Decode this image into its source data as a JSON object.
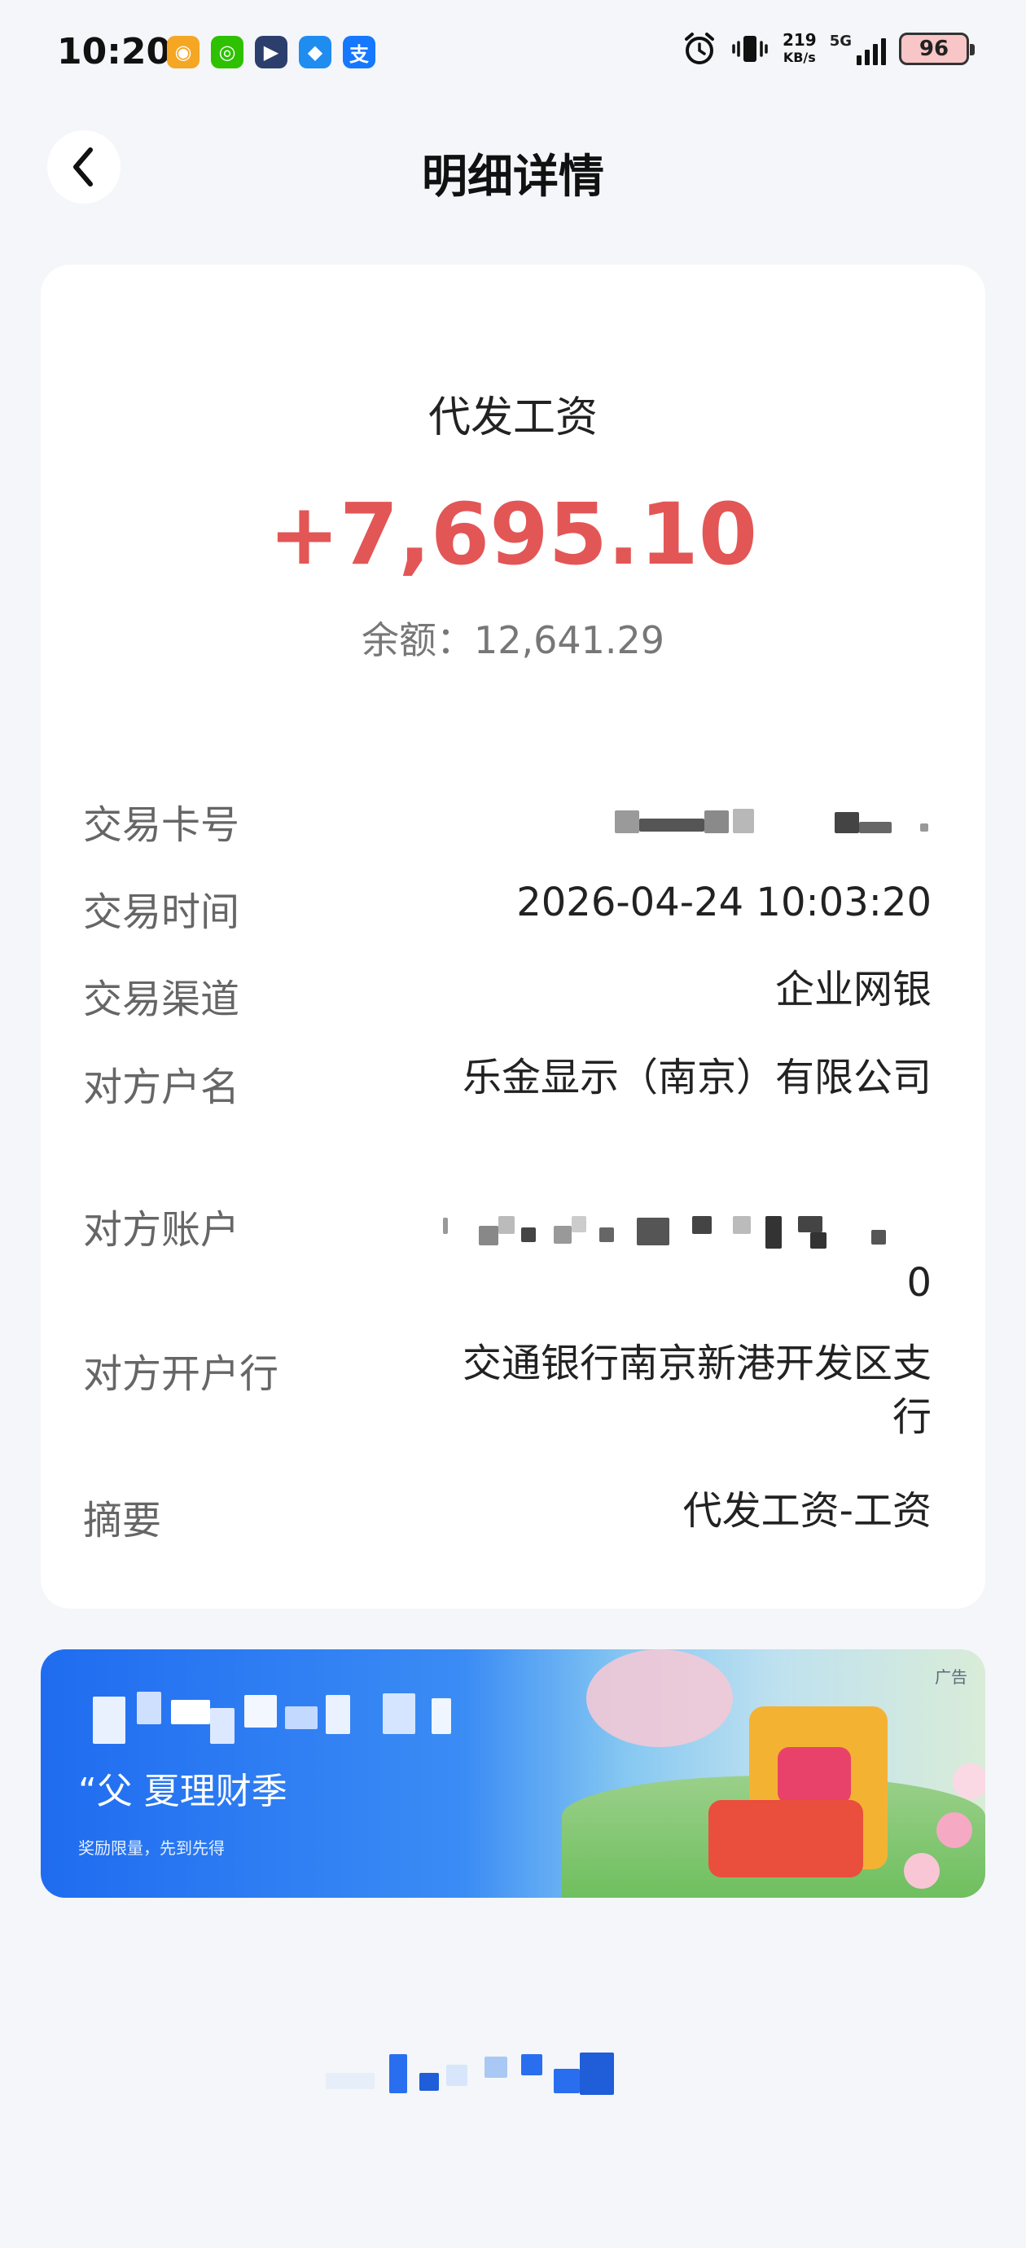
{
  "status_bar": {
    "time": "10:20",
    "apps": [
      {
        "icon": "weibo-icon",
        "glyph": "◉",
        "color": "#f5a623"
      },
      {
        "icon": "wechat-icon",
        "glyph": "◎",
        "color": "#2dc100"
      },
      {
        "icon": "video-app-icon",
        "glyph": "▶",
        "color": "#2c3e6b"
      },
      {
        "icon": "cloud-app-icon",
        "glyph": "◆",
        "color": "#1f8cf0"
      },
      {
        "icon": "alipay-icon",
        "glyph": "支",
        "color": "#1677ff"
      }
    ],
    "net_speed_value": "219",
    "net_speed_unit": "KB/s",
    "network": "5G",
    "battery": "96"
  },
  "header": {
    "title": "明细详情"
  },
  "transaction": {
    "type": "代发工资",
    "amount": "+7,695.10",
    "balance": "余额：12,641.29",
    "amount_color": "#e35656"
  },
  "details": {
    "card_no_label": "交易卡号",
    "time_label": "交易时间",
    "time_value": "2026-04-24 10:03:20",
    "channel_label": "交易渠道",
    "channel_value": "企业网银",
    "payer_name_label": "对方户名",
    "payer_name_value": "乐金显示（南京）有限公司",
    "payer_account_label": "对方账户",
    "payer_account_tail": "0",
    "payer_bank_label": "对方开户行",
    "payer_bank_value": "交通银行南京新港开发区支行",
    "memo_label": "摘要",
    "memo_value": "代发工资-工资"
  },
  "ad": {
    "tag": "广告",
    "headline": "“父  夏理财季",
    "subtext": "奖励限量，先到先得"
  }
}
